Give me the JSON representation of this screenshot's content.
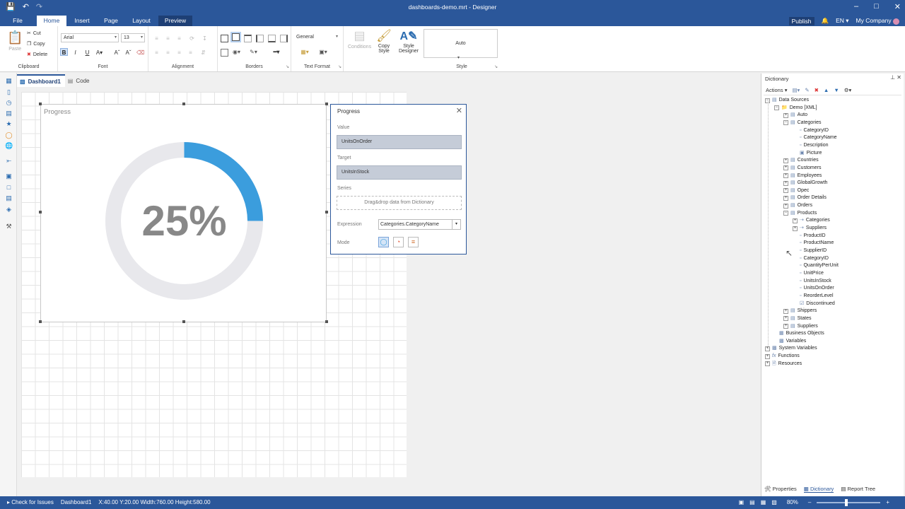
{
  "window": {
    "title": "dashboards-demo.mrt - Designer",
    "quick_access": [
      "save-icon",
      "undo-icon",
      "redo-icon"
    ],
    "controls": [
      "minimize-icon",
      "maximize-icon",
      "close-icon"
    ]
  },
  "menu": {
    "tabs": [
      "File",
      "Home",
      "Insert",
      "Page",
      "Layout",
      "Preview"
    ],
    "active_tab": "Home",
    "publish": "Publish",
    "language": "EN",
    "company": "My Company"
  },
  "ribbon": {
    "clipboard": {
      "paste": "Paste",
      "cut": "Cut",
      "copy": "Copy",
      "delete": "Delete",
      "label": "Clipboard"
    },
    "font": {
      "family": "Arial",
      "size": "13",
      "label": "Font"
    },
    "alignment": {
      "label": "Alignment"
    },
    "borders": {
      "label": "Borders"
    },
    "text_format": {
      "value": "General",
      "label": "Text Format"
    },
    "tools": {
      "conditions": "Conditions",
      "copy_style": "Copy Style",
      "style_designer": "Style Designer"
    },
    "style": {
      "value": "Auto",
      "label": "Style"
    }
  },
  "doc_tabs": [
    {
      "label": "Dashboard1",
      "active": true
    },
    {
      "label": "Code",
      "active": false
    }
  ],
  "widget": {
    "title": "Progress",
    "value_label": "25%",
    "progress": 0.25,
    "colors": {
      "fill": "#3b9ddd",
      "track": "#e8e8ec"
    }
  },
  "progress_panel": {
    "title": "Progress",
    "value_label": "Value",
    "value_field": "UnitsOnOrder",
    "target_label": "Target",
    "target_field": "UnitsInStock",
    "series_label": "Series",
    "series_placeholder": "Drag&drop data from Dictionary",
    "expression_label": "Expression",
    "expression_value": "Categories.CategoryName",
    "mode_label": "Mode"
  },
  "dictionary": {
    "title": "Dictionary",
    "actions": "Actions",
    "tree": [
      {
        "label": "Data Sources",
        "icon": "datasource-icon"
      },
      {
        "label": "Demo [XML]",
        "icon": "folder-icon"
      },
      {
        "label": "Auto",
        "icon": "table-icon"
      },
      {
        "label": "Categories",
        "icon": "table-icon"
      },
      {
        "label": "CategoryID",
        "icon": "column-icon"
      },
      {
        "label": "CategoryName",
        "icon": "column-icon"
      },
      {
        "label": "Description",
        "icon": "column-icon"
      },
      {
        "label": "Picture",
        "icon": "image-column-icon"
      },
      {
        "label": "Countries",
        "icon": "table-icon"
      },
      {
        "label": "Customers",
        "icon": "table-icon"
      },
      {
        "label": "Employees",
        "icon": "table-icon"
      },
      {
        "label": "GlobalGrowth",
        "icon": "table-icon"
      },
      {
        "label": "Opec",
        "icon": "table-icon"
      },
      {
        "label": "Order Details",
        "icon": "table-icon"
      },
      {
        "label": "Orders",
        "icon": "table-icon"
      },
      {
        "label": "Products",
        "icon": "table-icon"
      },
      {
        "label": "Categories",
        "icon": "relation-icon"
      },
      {
        "label": "Suppliers",
        "icon": "relation-icon"
      },
      {
        "label": "ProductID",
        "icon": "column-icon"
      },
      {
        "label": "ProductName",
        "icon": "column-icon"
      },
      {
        "label": "SupplierID",
        "icon": "column-icon"
      },
      {
        "label": "CategoryID",
        "icon": "column-icon"
      },
      {
        "label": "QuantityPerUnit",
        "icon": "column-icon"
      },
      {
        "label": "UnitPrice",
        "icon": "column-icon"
      },
      {
        "label": "UnitsInStock",
        "icon": "column-icon"
      },
      {
        "label": "UnitsOnOrder",
        "icon": "column-icon"
      },
      {
        "label": "ReorderLevel",
        "icon": "column-icon"
      },
      {
        "label": "Discontinued",
        "icon": "checkbox-column-icon"
      },
      {
        "label": "Shippers",
        "icon": "table-icon"
      },
      {
        "label": "States",
        "icon": "table-icon"
      },
      {
        "label": "Suppliers",
        "icon": "table-icon"
      },
      {
        "label": "Business Objects",
        "icon": "business-objects-icon"
      },
      {
        "label": "Variables",
        "icon": "variables-icon"
      },
      {
        "label": "System Variables",
        "icon": "variables-icon"
      },
      {
        "label": "Functions",
        "icon": "function-icon"
      },
      {
        "label": "Resources",
        "icon": "resources-icon"
      }
    ],
    "tabs": [
      "Properties",
      "Dictionary",
      "Report Tree"
    ],
    "active_tab": "Dictionary"
  },
  "status": {
    "check": "Check for Issues",
    "page": "Dashboard1",
    "coords": "X:40.00  Y:20.00  Width:760.00  Height:580.00",
    "zoom": "80%"
  }
}
